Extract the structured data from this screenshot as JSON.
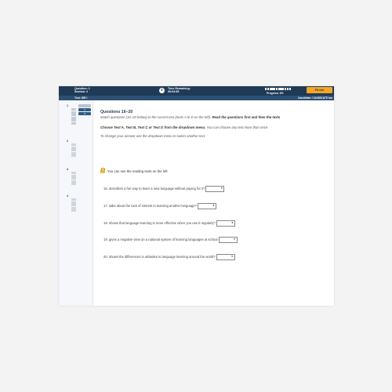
{
  "header": {
    "question_line": "Question: 1",
    "section_line": "Section: 2",
    "time_label": "Time Remaining:",
    "time_value": "00:03:55",
    "progress_label": "Progress: 0%",
    "finish_label": "Finish",
    "test_label": "Test: IDE I",
    "candidate_label": "Candidate: CANDIDATE Ian"
  },
  "sidebar": {
    "groups": [
      {
        "number": "1",
        "badges": [
          "",
          "1",
          "2"
        ]
      },
      {
        "number": "2",
        "badges": []
      },
      {
        "number": "3",
        "badges": []
      },
      {
        "number": "4",
        "badges": []
      }
    ]
  },
  "content": {
    "title": "Questions 16–20",
    "intro_plain": "Match questions (16–20 below) to the correct text (texts A to D on the left). ",
    "intro_bold": "Read the questions first and then the texts",
    "instr_bold": "Choose Text A, Text B, Text C or Text D from the dropdown menu.",
    "instr_plain": " You can choose any text more than once.",
    "instr2": "To change your answer use the dropdown menu to select another text.",
    "note": "You can see the reading texts on the left"
  },
  "questions": [
    {
      "text": "16. describes a fun way to learn a new language without paying for it?",
      "selected": ""
    },
    {
      "text": "17. talks about the lack of interest in learning another language?",
      "selected": ""
    },
    {
      "text": "18. shows that language learning is more effective when you use it regularly?",
      "selected": ""
    },
    {
      "text": "19. gives a negative view on a national system of learning languages at school",
      "selected": ""
    },
    {
      "text": "20. shows the differences in attitudes to language learning around the world?",
      "selected": ""
    }
  ],
  "colors": {
    "header_bg": "#1f3a57",
    "finish_button": "#f5a623",
    "active_badge": "#2e5a83"
  }
}
